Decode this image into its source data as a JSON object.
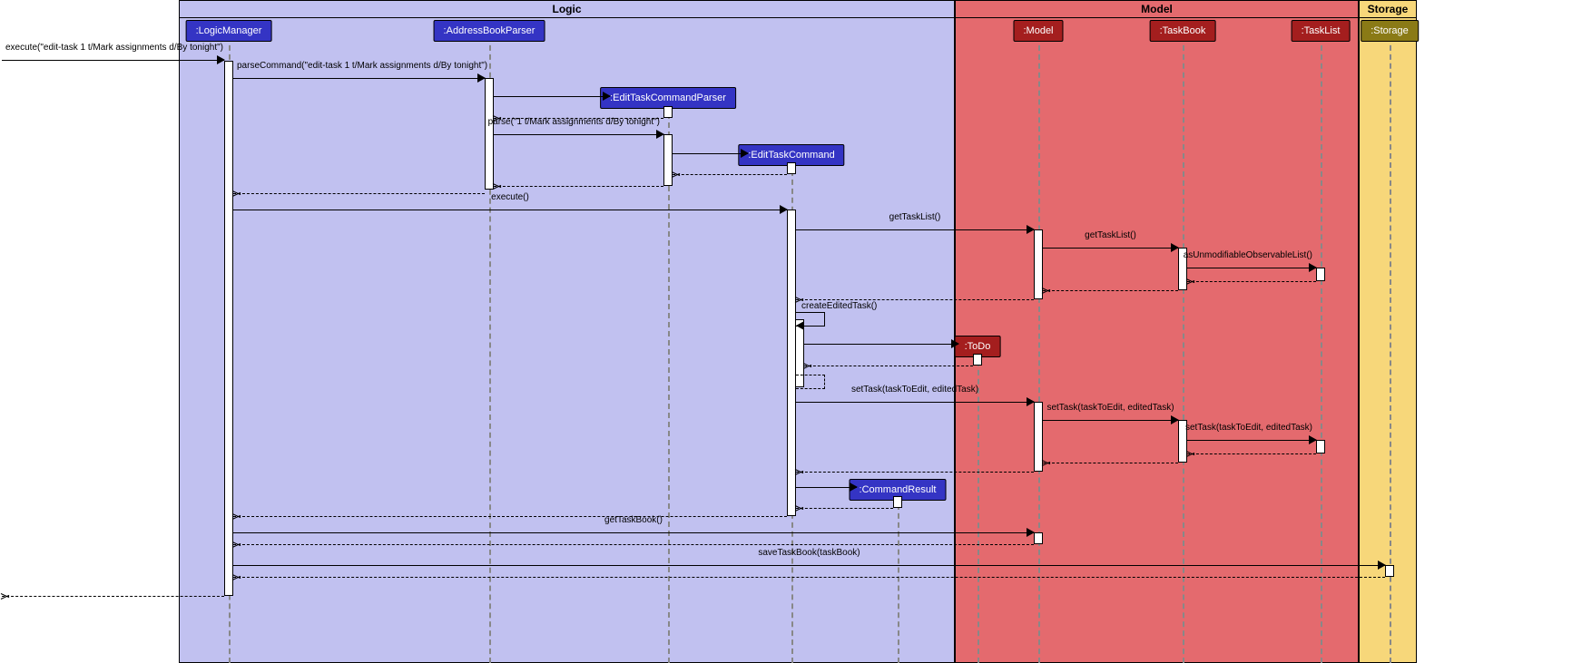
{
  "regions": {
    "logic": "Logic",
    "model": "Model",
    "storage": "Storage"
  },
  "participants": {
    "logicManager": ":LogicManager",
    "addressBookParser": ":AddressBookParser",
    "editTaskCommandParser": ":EditTaskCommandParser",
    "editTaskCommand": ":EditTaskCommand",
    "commandResult": ":CommandResult",
    "model": ":Model",
    "taskBook": ":TaskBook",
    "taskList": ":TaskList",
    "toDo": ":ToDo",
    "storage": ":Storage"
  },
  "messages": {
    "m1": "execute(\"edit-task 1 t/Mark assignments d/By tonight\")",
    "m2": "parseCommand(\"edit-task 1 t/Mark assignments d/By tonight\")",
    "m3": "parse(\"1 t/Mark assignments d/By tonight\")",
    "m4": "execute()",
    "m5": "getTaskList()",
    "m6": "getTaskList()",
    "m7": "asUnmodifiableObservableList()",
    "m8": "createEditedTask()",
    "m9": "setTask(taskToEdit, editedTask)",
    "m10": "setTask(taskToEdit, editedTask)",
    "m11": "setTask(taskToEdit, editedTask)",
    "m12": "getTaskBook()",
    "m13": "saveTaskBook(taskBook)"
  },
  "chart_data": {
    "type": "sequence-diagram",
    "regions": [
      "Logic",
      "Model",
      "Storage"
    ],
    "participants": [
      {
        "name": ":LogicManager",
        "region": "Logic"
      },
      {
        "name": ":AddressBookParser",
        "region": "Logic"
      },
      {
        "name": ":EditTaskCommandParser",
        "region": "Logic",
        "createdBy": ":AddressBookParser"
      },
      {
        "name": ":EditTaskCommand",
        "region": "Logic",
        "createdBy": ":EditTaskCommandParser"
      },
      {
        "name": ":CommandResult",
        "region": "Logic",
        "createdBy": ":EditTaskCommand"
      },
      {
        "name": ":Model",
        "region": "Model"
      },
      {
        "name": ":TaskBook",
        "region": "Model"
      },
      {
        "name": ":ToDo",
        "region": "Model",
        "createdBy": ":EditTaskCommand"
      },
      {
        "name": ":TaskList",
        "region": "Model"
      },
      {
        "name": ":Storage",
        "region": "Storage"
      }
    ],
    "messages": [
      {
        "from": "actor",
        "to": ":LogicManager",
        "label": "execute(\"edit-task 1 t/Mark assignments d/By tonight\")",
        "type": "sync"
      },
      {
        "from": ":LogicManager",
        "to": ":AddressBookParser",
        "label": "parseCommand(\"edit-task 1 t/Mark assignments d/By tonight\")",
        "type": "sync"
      },
      {
        "from": ":AddressBookParser",
        "to": ":EditTaskCommandParser",
        "label": "",
        "type": "create"
      },
      {
        "from": ":EditTaskCommandParser",
        "to": ":AddressBookParser",
        "label": "",
        "type": "return"
      },
      {
        "from": ":AddressBookParser",
        "to": ":EditTaskCommandParser",
        "label": "parse(\"1 t/Mark assignments d/By tonight\")",
        "type": "sync"
      },
      {
        "from": ":EditTaskCommandParser",
        "to": ":EditTaskCommand",
        "label": "",
        "type": "create"
      },
      {
        "from": ":EditTaskCommand",
        "to": ":EditTaskCommandParser",
        "label": "",
        "type": "return"
      },
      {
        "from": ":EditTaskCommandParser",
        "to": ":AddressBookParser",
        "label": "",
        "type": "return"
      },
      {
        "from": ":AddressBookParser",
        "to": ":LogicManager",
        "label": "",
        "type": "return"
      },
      {
        "from": ":LogicManager",
        "to": ":EditTaskCommand",
        "label": "execute()",
        "type": "sync"
      },
      {
        "from": ":EditTaskCommand",
        "to": ":Model",
        "label": "getTaskList()",
        "type": "sync"
      },
      {
        "from": ":Model",
        "to": ":TaskBook",
        "label": "getTaskList()",
        "type": "sync"
      },
      {
        "from": ":TaskBook",
        "to": ":TaskList",
        "label": "asUnmodifiableObservableList()",
        "type": "sync"
      },
      {
        "from": ":TaskList",
        "to": ":TaskBook",
        "label": "",
        "type": "return"
      },
      {
        "from": ":TaskBook",
        "to": ":Model",
        "label": "",
        "type": "return"
      },
      {
        "from": ":Model",
        "to": ":EditTaskCommand",
        "label": "",
        "type": "return"
      },
      {
        "from": ":EditTaskCommand",
        "to": ":EditTaskCommand",
        "label": "createEditedTask()",
        "type": "self"
      },
      {
        "from": ":EditTaskCommand",
        "to": ":ToDo",
        "label": "",
        "type": "create"
      },
      {
        "from": ":ToDo",
        "to": ":EditTaskCommand",
        "label": "",
        "type": "return"
      },
      {
        "from": ":EditTaskCommand",
        "to": ":EditTaskCommand",
        "label": "",
        "type": "self-return"
      },
      {
        "from": ":EditTaskCommand",
        "to": ":Model",
        "label": "setTask(taskToEdit, editedTask)",
        "type": "sync"
      },
      {
        "from": ":Model",
        "to": ":TaskBook",
        "label": "setTask(taskToEdit, editedTask)",
        "type": "sync"
      },
      {
        "from": ":TaskBook",
        "to": ":TaskList",
        "label": "setTask(taskToEdit, editedTask)",
        "type": "sync"
      },
      {
        "from": ":TaskList",
        "to": ":TaskBook",
        "label": "",
        "type": "return"
      },
      {
        "from": ":TaskBook",
        "to": ":Model",
        "label": "",
        "type": "return"
      },
      {
        "from": ":Model",
        "to": ":EditTaskCommand",
        "label": "",
        "type": "return"
      },
      {
        "from": ":EditTaskCommand",
        "to": ":CommandResult",
        "label": "",
        "type": "create"
      },
      {
        "from": ":CommandResult",
        "to": ":EditTaskCommand",
        "label": "",
        "type": "return"
      },
      {
        "from": ":EditTaskCommand",
        "to": ":LogicManager",
        "label": "",
        "type": "return"
      },
      {
        "from": ":LogicManager",
        "to": ":Model",
        "label": "getTaskBook()",
        "type": "sync"
      },
      {
        "from": ":Model",
        "to": ":LogicManager",
        "label": "",
        "type": "return"
      },
      {
        "from": ":LogicManager",
        "to": ":Storage",
        "label": "saveTaskBook(taskBook)",
        "type": "sync"
      },
      {
        "from": ":Storage",
        "to": ":LogicManager",
        "label": "",
        "type": "return"
      },
      {
        "from": ":LogicManager",
        "to": "actor",
        "label": "",
        "type": "return"
      }
    ]
  }
}
